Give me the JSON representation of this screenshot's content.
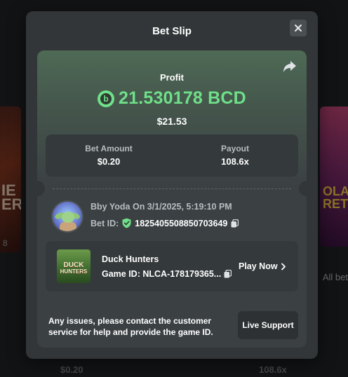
{
  "background": {
    "left_card_text": "IE\nER",
    "left_card_count": "8",
    "right_card_text": "OLAT\nRET",
    "right_all_bets": "All bet",
    "row_amount": "$0.20",
    "row_payout": "108.6x"
  },
  "modal": {
    "title": "Bet Slip",
    "profit_label": "Profit",
    "profit_value": "21.530178 BCD",
    "profit_usd": "$21.53",
    "bet_amount_label": "Bet Amount",
    "bet_amount_value": "$0.20",
    "payout_label": "Payout",
    "payout_value": "108.6x",
    "user_line": "Bby Yoda On 3/1/2025, 5:19:10 PM",
    "bet_id_label": "Bet ID:",
    "bet_id_value": "1825405508850703649",
    "game_name": "Duck Hunters",
    "game_id": "Game ID: NLCA-178179365...",
    "game_thumb_line1": "DUCK",
    "game_thumb_line2": "HUNTERS",
    "play_now": "Play Now",
    "support_text": "Any issues, please contact the customer service for help and provide the game ID.",
    "support_button": "Live Support"
  },
  "colors": {
    "accent_green": "#6fe08a",
    "modal_bg": "#323638",
    "panel_bg": "#3b4043"
  },
  "icons": [
    "close-icon",
    "share-icon",
    "bcd-coin-icon",
    "verified-shield-icon",
    "copy-icon",
    "chevron-right-icon"
  ]
}
